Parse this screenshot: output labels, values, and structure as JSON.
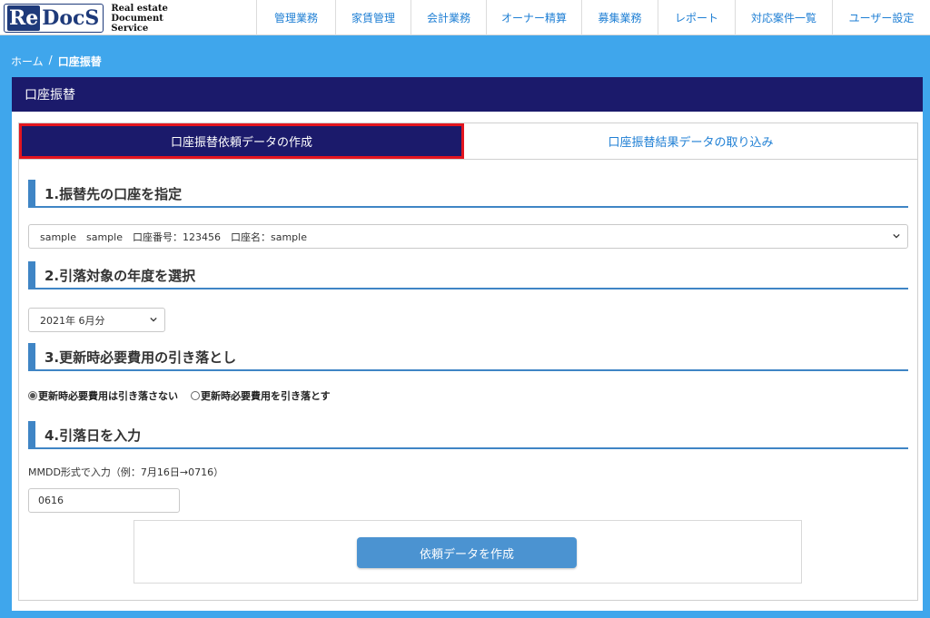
{
  "brand": {
    "mark_re": "Re",
    "mark_docs": "DocS",
    "sub_line1": "Real estate",
    "sub_line2": "Document Service"
  },
  "nav": [
    {
      "label": "管理業務"
    },
    {
      "label": "家賃管理"
    },
    {
      "label": "会計業務"
    },
    {
      "label": "オーナー精算"
    },
    {
      "label": "募集業務"
    },
    {
      "label": "レポート"
    },
    {
      "label": "対応案件一覧"
    },
    {
      "label": "ユーザー設定"
    }
  ],
  "breadcrumb": {
    "home": "ホーム",
    "separator": "/",
    "current": "口座振替"
  },
  "panel": {
    "title": "口座振替"
  },
  "tabs": {
    "create": "口座振替依頼データの作成",
    "import": "口座振替結果データの取り込み"
  },
  "sections": {
    "account": {
      "heading": "1.振替先の口座を指定",
      "selected": "sample　sample　口座番号：123456　口座名：sample"
    },
    "period": {
      "heading": "2.引落対象の年度を選択",
      "selected": "2021年 6月分"
    },
    "renewal": {
      "heading": "3.更新時必要費用の引き落とし",
      "option_no": "更新時必要費用は引き落さない",
      "option_yes": "更新時必要費用を引き落とす"
    },
    "date": {
      "heading": "4.引落日を入力",
      "hint": "MMDD形式で入力（例：7月16日→0716）",
      "value": "0616"
    }
  },
  "actions": {
    "create_label": "依頼データを作成"
  },
  "colors": {
    "header_bg": "#ffffff",
    "page_bg": "#3fa6ec",
    "panel_title": "#1b1a6b",
    "accent": "#3f85c5",
    "highlight": "#e3151f",
    "button": "#4b93d1"
  }
}
